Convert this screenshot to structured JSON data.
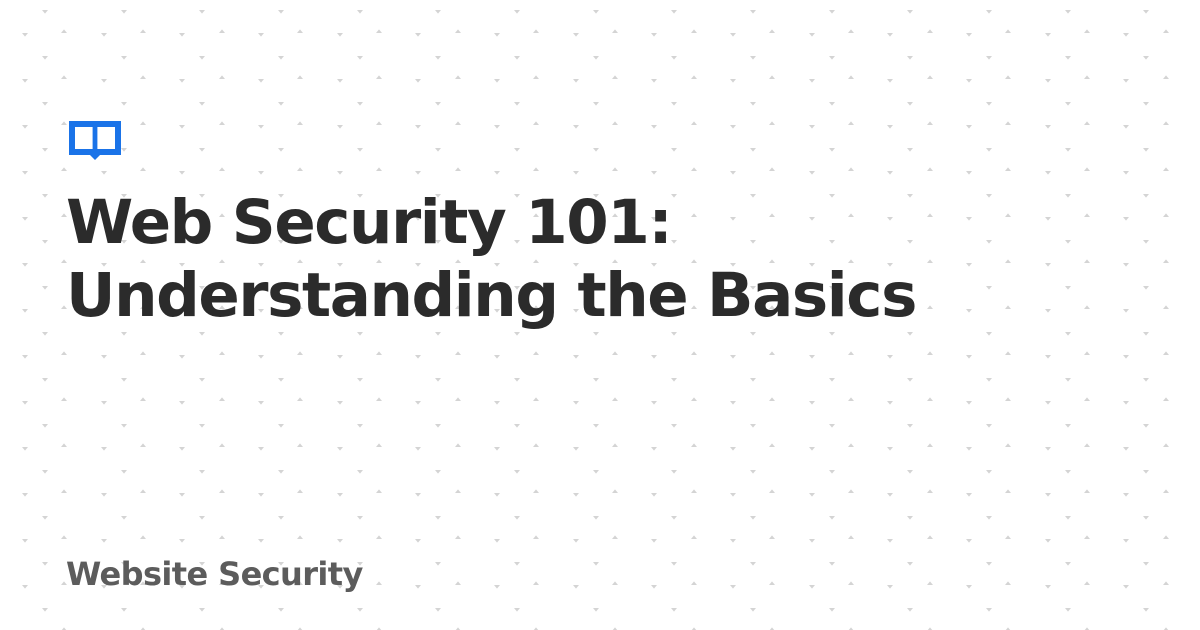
{
  "post": {
    "title": "Web Security 101: Understanding the Basics",
    "category": "Website Security"
  },
  "logo": {
    "icon": "open-book-icon",
    "color": "#1a73e8"
  },
  "colors": {
    "background": "#ffffff",
    "pattern": "#d4d4d4",
    "title": "#2b2b2b",
    "category": "#5c5c5c"
  }
}
